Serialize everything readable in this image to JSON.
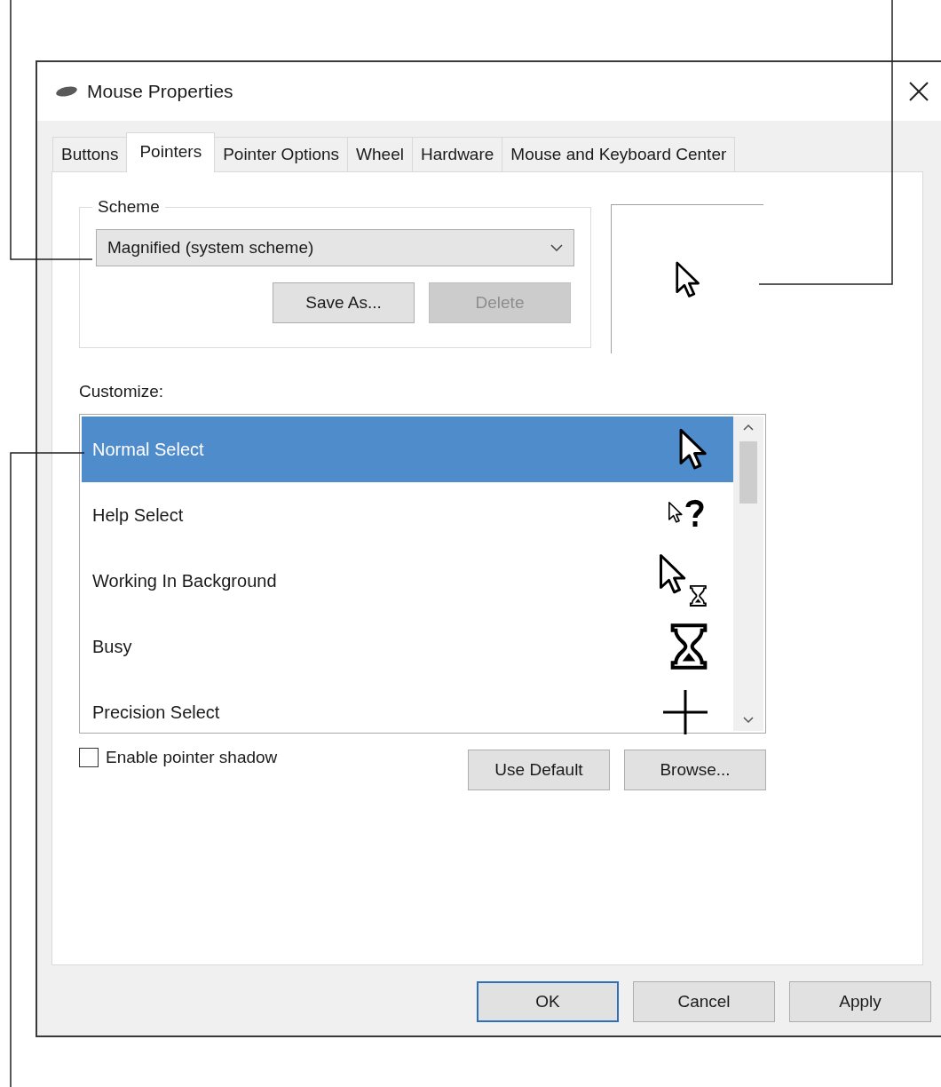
{
  "window": {
    "title": "Mouse Properties"
  },
  "tabs": [
    {
      "label": "Buttons",
      "selected": false
    },
    {
      "label": "Pointers",
      "selected": true
    },
    {
      "label": "Pointer Options",
      "selected": false
    },
    {
      "label": "Wheel",
      "selected": false
    },
    {
      "label": "Hardware",
      "selected": false
    },
    {
      "label": "Mouse and Keyboard Center",
      "selected": false
    }
  ],
  "scheme": {
    "label": "Scheme",
    "value": "Magnified (system scheme)",
    "buttons": [
      {
        "label": "Save As...",
        "disabled": false
      },
      {
        "label": "Delete",
        "disabled": true
      }
    ]
  },
  "customize": {
    "label": "Customize:",
    "items": [
      {
        "name": "Normal Select",
        "kind": "arrow",
        "selected": true
      },
      {
        "name": "Help Select",
        "kind": "help",
        "selected": false
      },
      {
        "name": "Working In Background",
        "kind": "working",
        "selected": false
      },
      {
        "name": "Busy",
        "kind": "busy",
        "selected": false
      },
      {
        "name": "Precision Select",
        "kind": "precision",
        "selected": false
      }
    ]
  },
  "shadow": {
    "label": "Enable pointer shadow",
    "checked": false
  },
  "list_buttons": [
    {
      "label": "Use Default"
    },
    {
      "label": "Browse..."
    }
  ],
  "buttons": [
    {
      "label": "OK",
      "default": true
    },
    {
      "label": "Cancel",
      "default": false
    },
    {
      "label": "Apply",
      "default": false
    }
  ]
}
